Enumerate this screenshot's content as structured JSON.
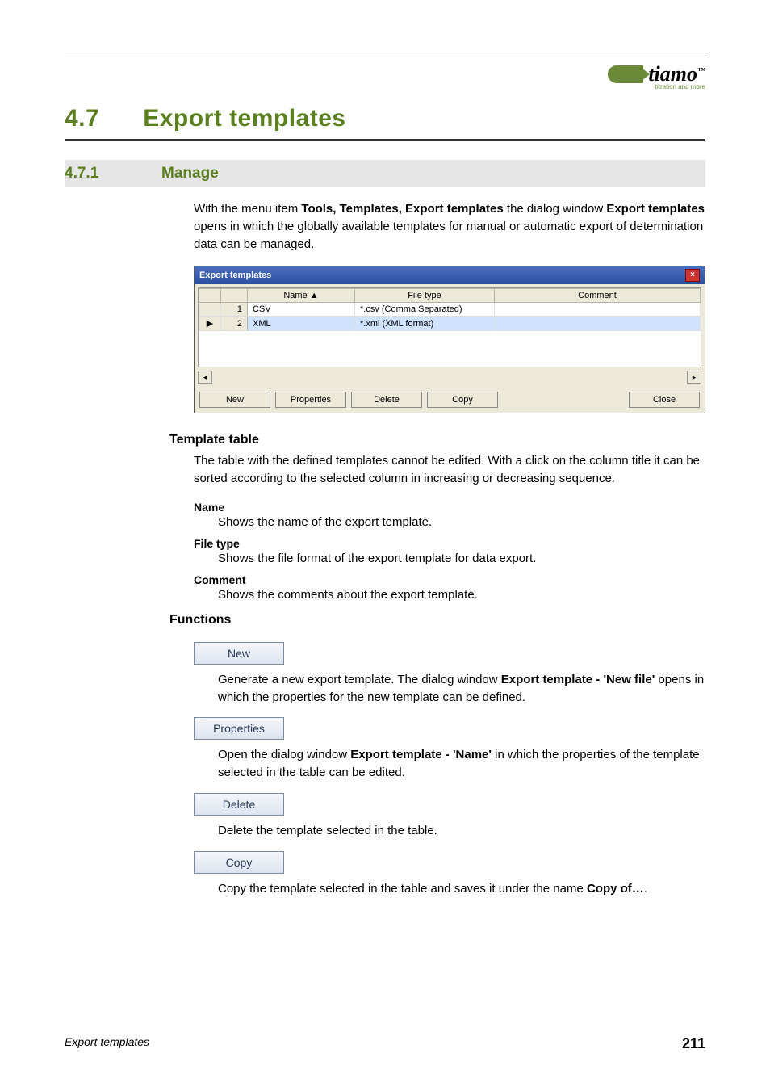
{
  "brand": {
    "name": "tiamo",
    "tm": "™",
    "tagline": "titration and more"
  },
  "section": {
    "number": "4.7",
    "title": "Export templates"
  },
  "subsection": {
    "number": "4.7.1",
    "title": "Manage"
  },
  "intro": {
    "pre": "With the menu item ",
    "menu": "Tools, Templates, Export templates",
    "mid": " the dialog window ",
    "dlg": "Export templates",
    "post": " opens in which the globally available templates for manual or automatic export of determination data can be managed."
  },
  "dialog": {
    "title": "Export templates",
    "close": "×",
    "columns": {
      "c0": "",
      "c1": "",
      "name": "Name ▲",
      "file": "File type",
      "comment": "Comment"
    },
    "rows": [
      {
        "sel": "",
        "idx": "1",
        "name": "CSV",
        "file": "*.csv (Comma Separated)",
        "comment": ""
      },
      {
        "sel": "▶",
        "idx": "2",
        "name": "XML",
        "file": "*.xml (XML format)",
        "comment": ""
      }
    ],
    "scroll": {
      "left": "◂",
      "right": "▸"
    },
    "buttons": {
      "new": "New",
      "properties": "Properties",
      "delete": "Delete",
      "copy": "Copy",
      "close": "Close"
    }
  },
  "templateTable": {
    "heading": "Template table",
    "desc": "The table with the defined templates cannot be edited. With a click on the column title it can be sorted according to the selected column in increasing or decreasing sequence.",
    "fields": [
      {
        "label": "Name",
        "desc": "Shows the name of the export template."
      },
      {
        "label": "File type",
        "desc": "Shows the file format of the export template for data export."
      },
      {
        "label": "Comment",
        "desc": "Shows the comments about the export template."
      }
    ]
  },
  "functions": {
    "heading": "Functions",
    "items": [
      {
        "btn": "New",
        "d1": "Generate a new export template. The dialog window ",
        "bold": "Export template - 'New file'",
        "d2": " opens in which the properties for the new template can be defined."
      },
      {
        "btn": "Properties",
        "d1": "Open the dialog window ",
        "bold": "Export template - 'Name'",
        "d2": " in which the properties of the template selected in the table can be edited."
      },
      {
        "btn": "Delete",
        "d1": "Delete the template selected in the table.",
        "bold": "",
        "d2": ""
      },
      {
        "btn": "Copy",
        "d1": "Copy the template selected in the table and saves it under the name ",
        "bold": "Copy of…",
        "d2": "."
      }
    ]
  },
  "footer": {
    "label": "Export templates",
    "page": "211"
  }
}
